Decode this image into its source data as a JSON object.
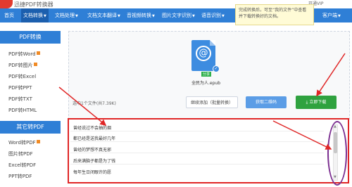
{
  "header": {
    "brand": "迅捷PDF转换器",
    "right_links": [
      "开通VIP",
      "客户端"
    ]
  },
  "nav": {
    "items": [
      {
        "label": "首页",
        "active": false
      },
      {
        "label": "文档转换",
        "active": true
      },
      {
        "label": "文档处理",
        "active": false
      },
      {
        "label": "文档文本翻译",
        "active": false
      },
      {
        "label": "音视频转换",
        "active": false
      },
      {
        "label": "图片文字识别",
        "active": false
      },
      {
        "label": "语音识别",
        "active": false
      },
      {
        "label": "客户端",
        "active": false
      }
    ]
  },
  "tooltip": {
    "text": "完成转换后，可至“我的文件”中查看并下载转换好的文档。"
  },
  "sidebar": {
    "section1_title": "PDF转换",
    "section1_items": [
      {
        "label": "PDF转Word",
        "hot": true
      },
      {
        "label": "PDF转图片",
        "hot": true
      },
      {
        "label": "PDF转Excel",
        "hot": false
      },
      {
        "label": "PDF转PPT",
        "hot": false
      },
      {
        "label": "PDF转TXT",
        "hot": false
      },
      {
        "label": "PDF转HTML",
        "hot": false
      }
    ],
    "section2_title": "其它转PDF",
    "section2_items": [
      {
        "label": "Word转PDF",
        "hot": true
      },
      {
        "label": "图片转PDF",
        "hot": false
      },
      {
        "label": "Excel转PDF",
        "hot": false
      },
      {
        "label": "PPT转PDF",
        "hot": false
      }
    ]
  },
  "file": {
    "name": "全民为人.epub",
    "badge": "分享",
    "icon": "epub-file-icon"
  },
  "actions": {
    "selection_info": "选中1个文件(共7.39K)",
    "continue_label": "继续添加（批量转换）",
    "qr_label": "获取二维码",
    "download_label": "立即下载"
  },
  "content_lines": [
    "曾经说过不会抽的烟",
    "都已经是送我最好几年",
    "曾经的梦想不真无邪",
    "后来满脑子都是为了钱",
    "每年生日闭眼许的愿"
  ],
  "colors": {
    "nav_blue": "#2f7fd6",
    "download_green": "#2fa23f",
    "highlight_red": "#e02626",
    "ellipse_purple": "#7b2f90"
  }
}
